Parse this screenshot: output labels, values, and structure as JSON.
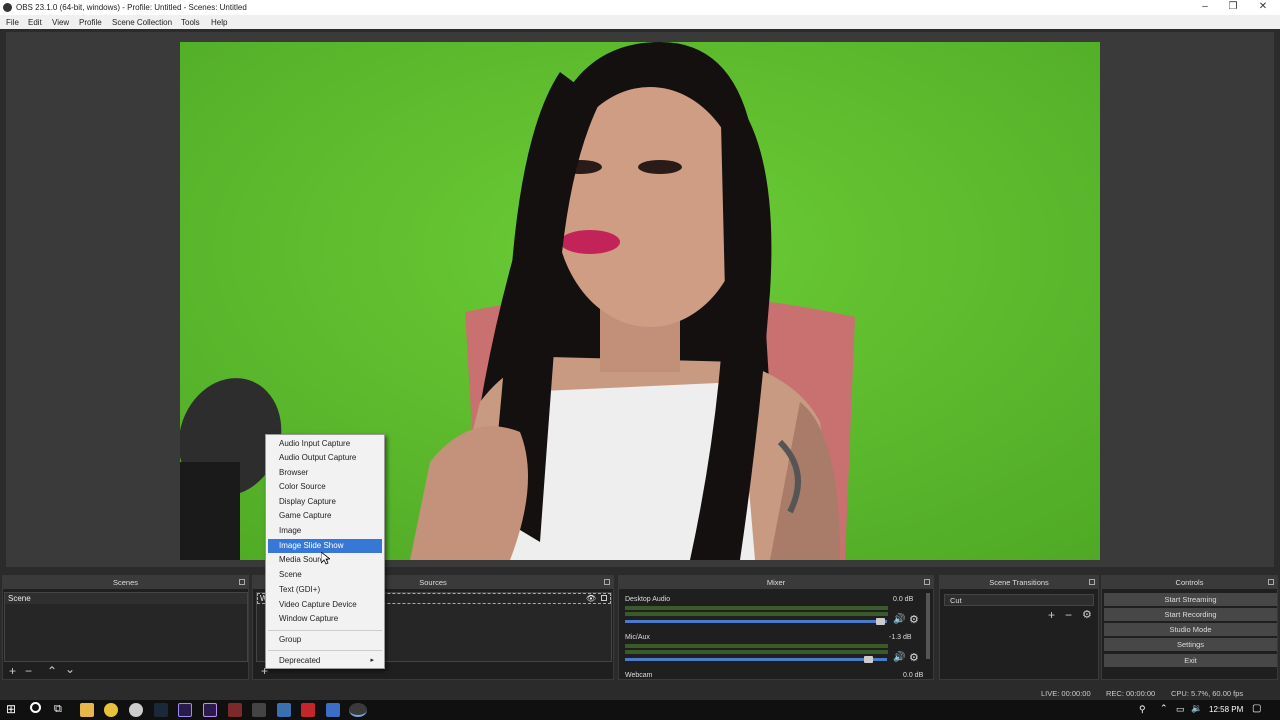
{
  "window": {
    "title": "OBS 23.1.0 (64-bit, windows) - Profile: Untitled - Scenes: Untitled"
  },
  "menu": [
    "File",
    "Edit",
    "View",
    "Profile",
    "Scene Collection",
    "Tools",
    "Help"
  ],
  "docks": {
    "scenes": {
      "title": "Scenes",
      "items": [
        "Scene"
      ]
    },
    "sources": {
      "title": "Sources",
      "items": [
        "We"
      ]
    },
    "mixer": {
      "title": "Mixer",
      "channels": [
        {
          "name": "Desktop Audio",
          "db": "0.0 dB",
          "volume": 0.98
        },
        {
          "name": "Mic/Aux",
          "db": "-1.3 dB",
          "volume": 0.88
        },
        {
          "name": "Webcam",
          "db": "0.0 dB"
        }
      ]
    },
    "transitions": {
      "title": "Scene Transitions",
      "selected": "Cut"
    },
    "controls": {
      "title": "Controls",
      "buttons": [
        "Start Streaming",
        "Start Recording",
        "Studio Mode",
        "Settings",
        "Exit"
      ]
    }
  },
  "context_menu": {
    "items": [
      "Audio Input Capture",
      "Audio Output Capture",
      "Browser",
      "Color Source",
      "Display Capture",
      "Game Capture",
      "Image",
      "Image Slide Show",
      "Media Source",
      "Scene",
      "Text (GDI+)",
      "Video Capture Device",
      "Window Capture",
      "Group",
      "Deprecated"
    ],
    "highlighted": "Image Slide Show"
  },
  "status": {
    "live": "LIVE: 00:00:00",
    "rec": "REC: 00:00:00",
    "cpu": "CPU: 5.7%, 60.00 fps"
  },
  "taskbar": {
    "time": "12:58 PM"
  },
  "colors": {
    "accent": "#3778d6",
    "chroma_green": "#5fb92f"
  }
}
